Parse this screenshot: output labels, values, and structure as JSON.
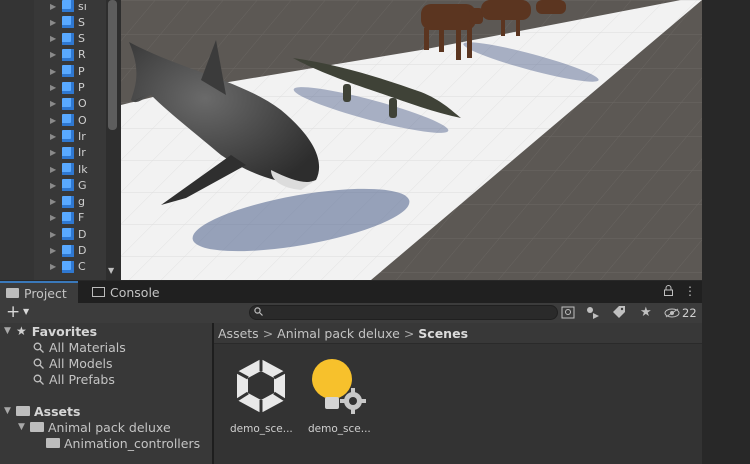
{
  "hierarchy": {
    "items": [
      {
        "label": "sı"
      },
      {
        "label": "S"
      },
      {
        "label": "S"
      },
      {
        "label": "R"
      },
      {
        "label": "P"
      },
      {
        "label": "P"
      },
      {
        "label": "O"
      },
      {
        "label": "O"
      },
      {
        "label": "Ir"
      },
      {
        "label": "Ir"
      },
      {
        "label": "Ik"
      },
      {
        "label": "G"
      },
      {
        "label": "g"
      },
      {
        "label": "F"
      },
      {
        "label": "D"
      },
      {
        "label": "D"
      },
      {
        "label": "C"
      }
    ]
  },
  "tabs": {
    "project": "Project",
    "console": "Console"
  },
  "toolbar": {
    "search_placeholder": "",
    "hidden_count": "22"
  },
  "tree": {
    "favorites": "Favorites",
    "fav_items": [
      "All Materials",
      "All Models",
      "All Prefabs"
    ],
    "assets": "Assets",
    "animal_pack": "Animal pack deluxe",
    "anim_controllers": "Animation_controllers"
  },
  "breadcrumb": [
    "Assets",
    "Animal pack deluxe",
    "Scenes"
  ],
  "assets": [
    {
      "label": "demo_sce...",
      "icon": "unity-scene-icon"
    },
    {
      "label": "demo_sce...",
      "icon": "lighting-settings-icon"
    }
  ],
  "colors": {
    "accent": "#3a79bb",
    "cube": "#59a9ff"
  }
}
